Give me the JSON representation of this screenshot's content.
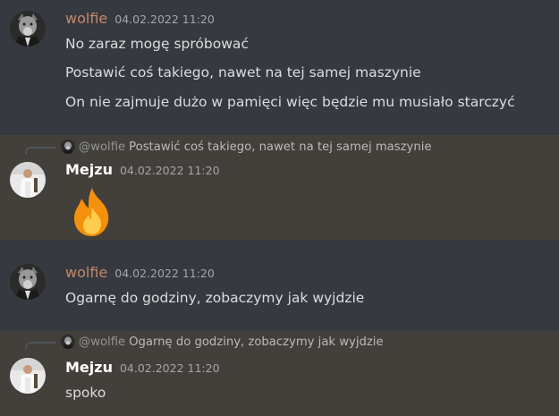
{
  "messages": [
    {
      "author": "wolfie",
      "timestamp": "04.02.2022 11:20",
      "lines": [
        "No zaraz mogę spróbować",
        "Postawić coś takiego, nawet na tej samej maszynie",
        "On nie zajmuje dużo w pamięci więc będzie mu musiało starczyć"
      ]
    },
    {
      "reply": {
        "mention": "@wolfie",
        "text": "Postawić coś takiego, nawet na tej samej maszynie"
      },
      "author": "Mejzu",
      "timestamp": "04.02.2022 11:20",
      "emoji": "fire-emoji"
    },
    {
      "author": "wolfie",
      "timestamp": "04.02.2022 11:20",
      "lines": [
        "Ogarnę do godziny, zobaczymy jak wyjdzie"
      ]
    },
    {
      "reply": {
        "mention": "@wolfie",
        "text": "Ogarnę do godziny, zobaczymy jak wyjdzie"
      },
      "author": "Mejzu",
      "timestamp": "04.02.2022 11:20",
      "lines": [
        "spoko"
      ]
    }
  ],
  "colors": {
    "background": "#36393f",
    "highlight": "#433f3a",
    "wolfie_name": "#c5896a",
    "mejzu_name": "#ffffff",
    "text": "#dcddde",
    "timestamp": "#a3a6aa"
  }
}
